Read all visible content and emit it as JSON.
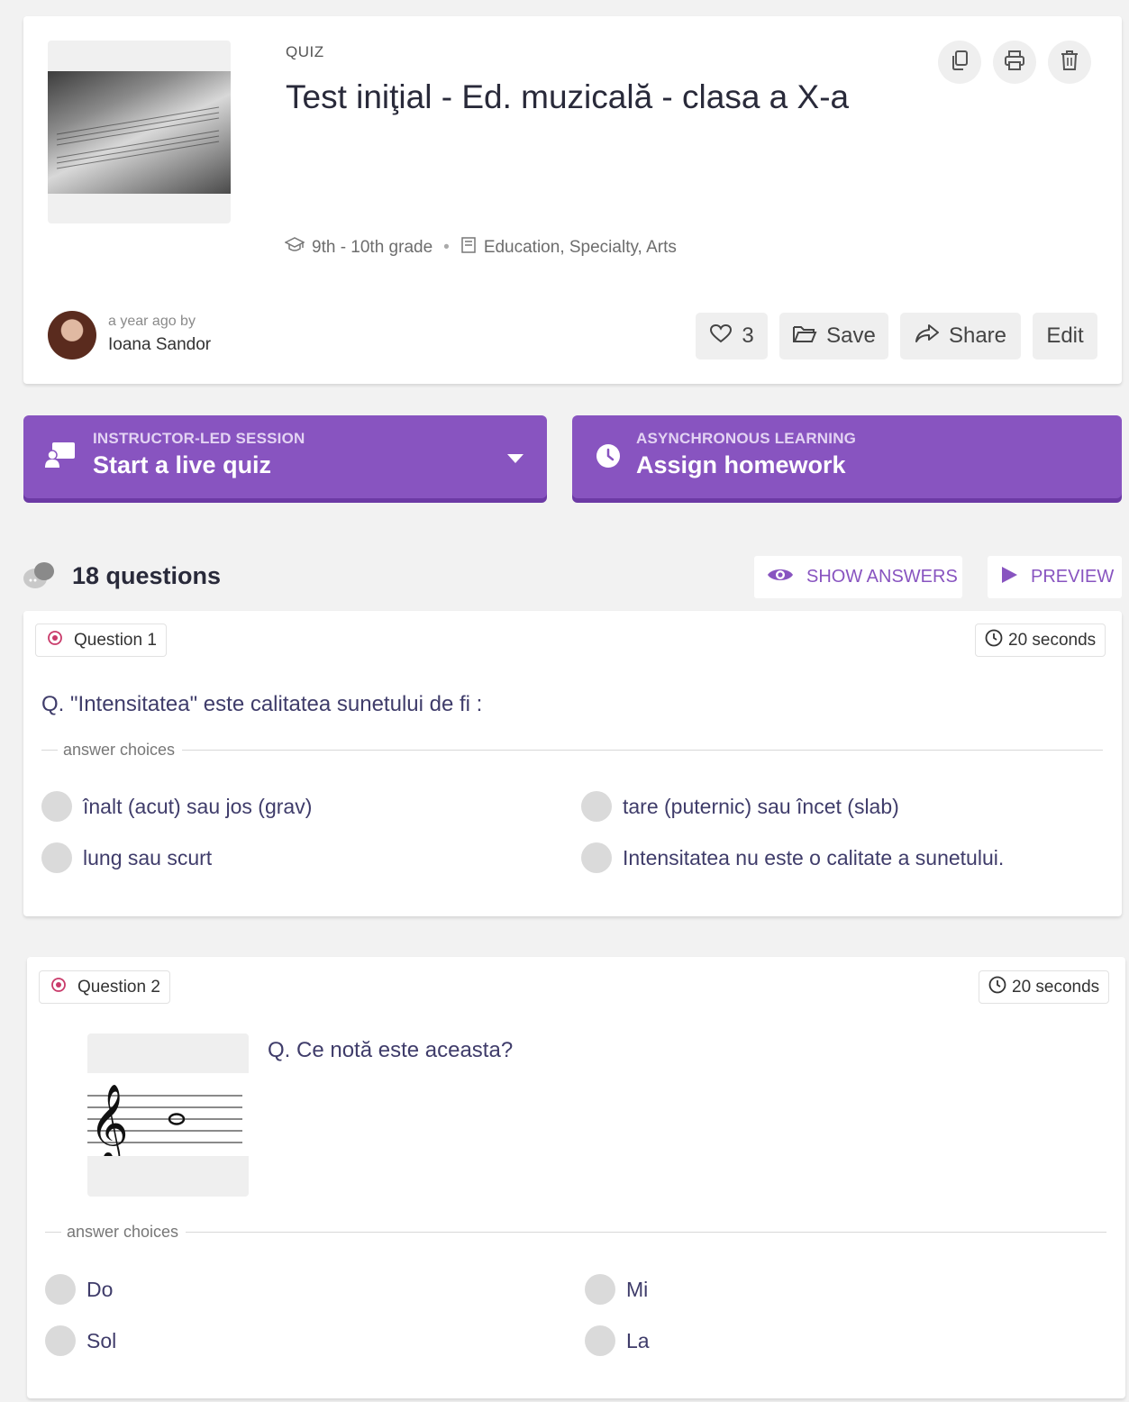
{
  "quiz": {
    "kicker": "QUIZ",
    "title": "Test iniţial - Ed. muzicală - clasa a X-a",
    "grade": "9th - 10th grade",
    "subjects": "Education, Specialty, Arts",
    "byline_time": "a year ago by",
    "author": "Ioana Sandor",
    "likes": "3",
    "save_label": "Save",
    "share_label": "Share",
    "edit_label": "Edit"
  },
  "actions": {
    "live": {
      "kicker": "INSTRUCTOR-LED SESSION",
      "label": "Start a live quiz"
    },
    "homework": {
      "kicker": "ASYNCHRONOUS LEARNING",
      "label": "Assign homework"
    }
  },
  "questions_header": {
    "count_label": "18 questions",
    "show_answers_label": "SHOW ANSWERS",
    "preview_label": "PREVIEW"
  },
  "answer_choices_label": "answer choices",
  "questions": [
    {
      "tag": "Question 1",
      "time": "20 seconds",
      "text": "Q. \"Intensitatea\" este calitatea sunetului de fi :",
      "choices": [
        "înalt (acut) sau jos (grav)",
        "tare (puternic) sau încet (slab)",
        "lung sau scurt",
        "Intensitatea nu este o calitate a sunetului."
      ]
    },
    {
      "tag": "Question 2",
      "time": "20 seconds",
      "text": "Q. Ce notă este aceasta?",
      "choices": [
        "Do",
        "Mi",
        "Sol",
        "La"
      ]
    }
  ],
  "colors": {
    "accent": "#8854c0",
    "accent_shadow": "#6c3aa5",
    "question_text": "#3f3c6a",
    "tag_icon": "#c93a6a"
  }
}
